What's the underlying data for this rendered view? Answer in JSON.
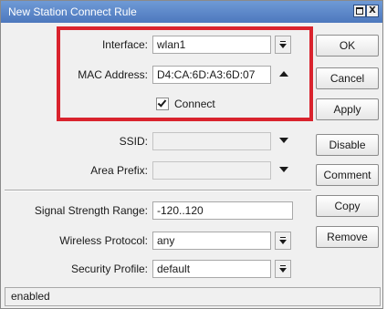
{
  "window": {
    "title": "New Station Connect Rule",
    "maximize_glyph": "",
    "close_glyph": "X"
  },
  "form": {
    "interface": {
      "label": "Interface:",
      "value": "wlan1"
    },
    "mac_address": {
      "label": "MAC Address:",
      "value": "D4:CA:6D:A3:6D:07"
    },
    "connect": {
      "label": "Connect",
      "checked": true
    },
    "ssid": {
      "label": "SSID:",
      "value": ""
    },
    "area_prefix": {
      "label": "Area Prefix:",
      "value": ""
    },
    "signal_strength_range": {
      "label": "Signal Strength Range:",
      "value": "-120..120"
    },
    "wireless_protocol": {
      "label": "Wireless Protocol:",
      "value": "any"
    },
    "security_profile": {
      "label": "Security Profile:",
      "value": "default"
    }
  },
  "buttons": {
    "ok": "OK",
    "cancel": "Cancel",
    "apply": "Apply",
    "disable": "Disable",
    "comment": "Comment",
    "copy": "Copy",
    "remove": "Remove"
  },
  "status": "enabled",
  "colors": {
    "highlight": "#d9232d",
    "titlebar": "#5a86c9"
  }
}
